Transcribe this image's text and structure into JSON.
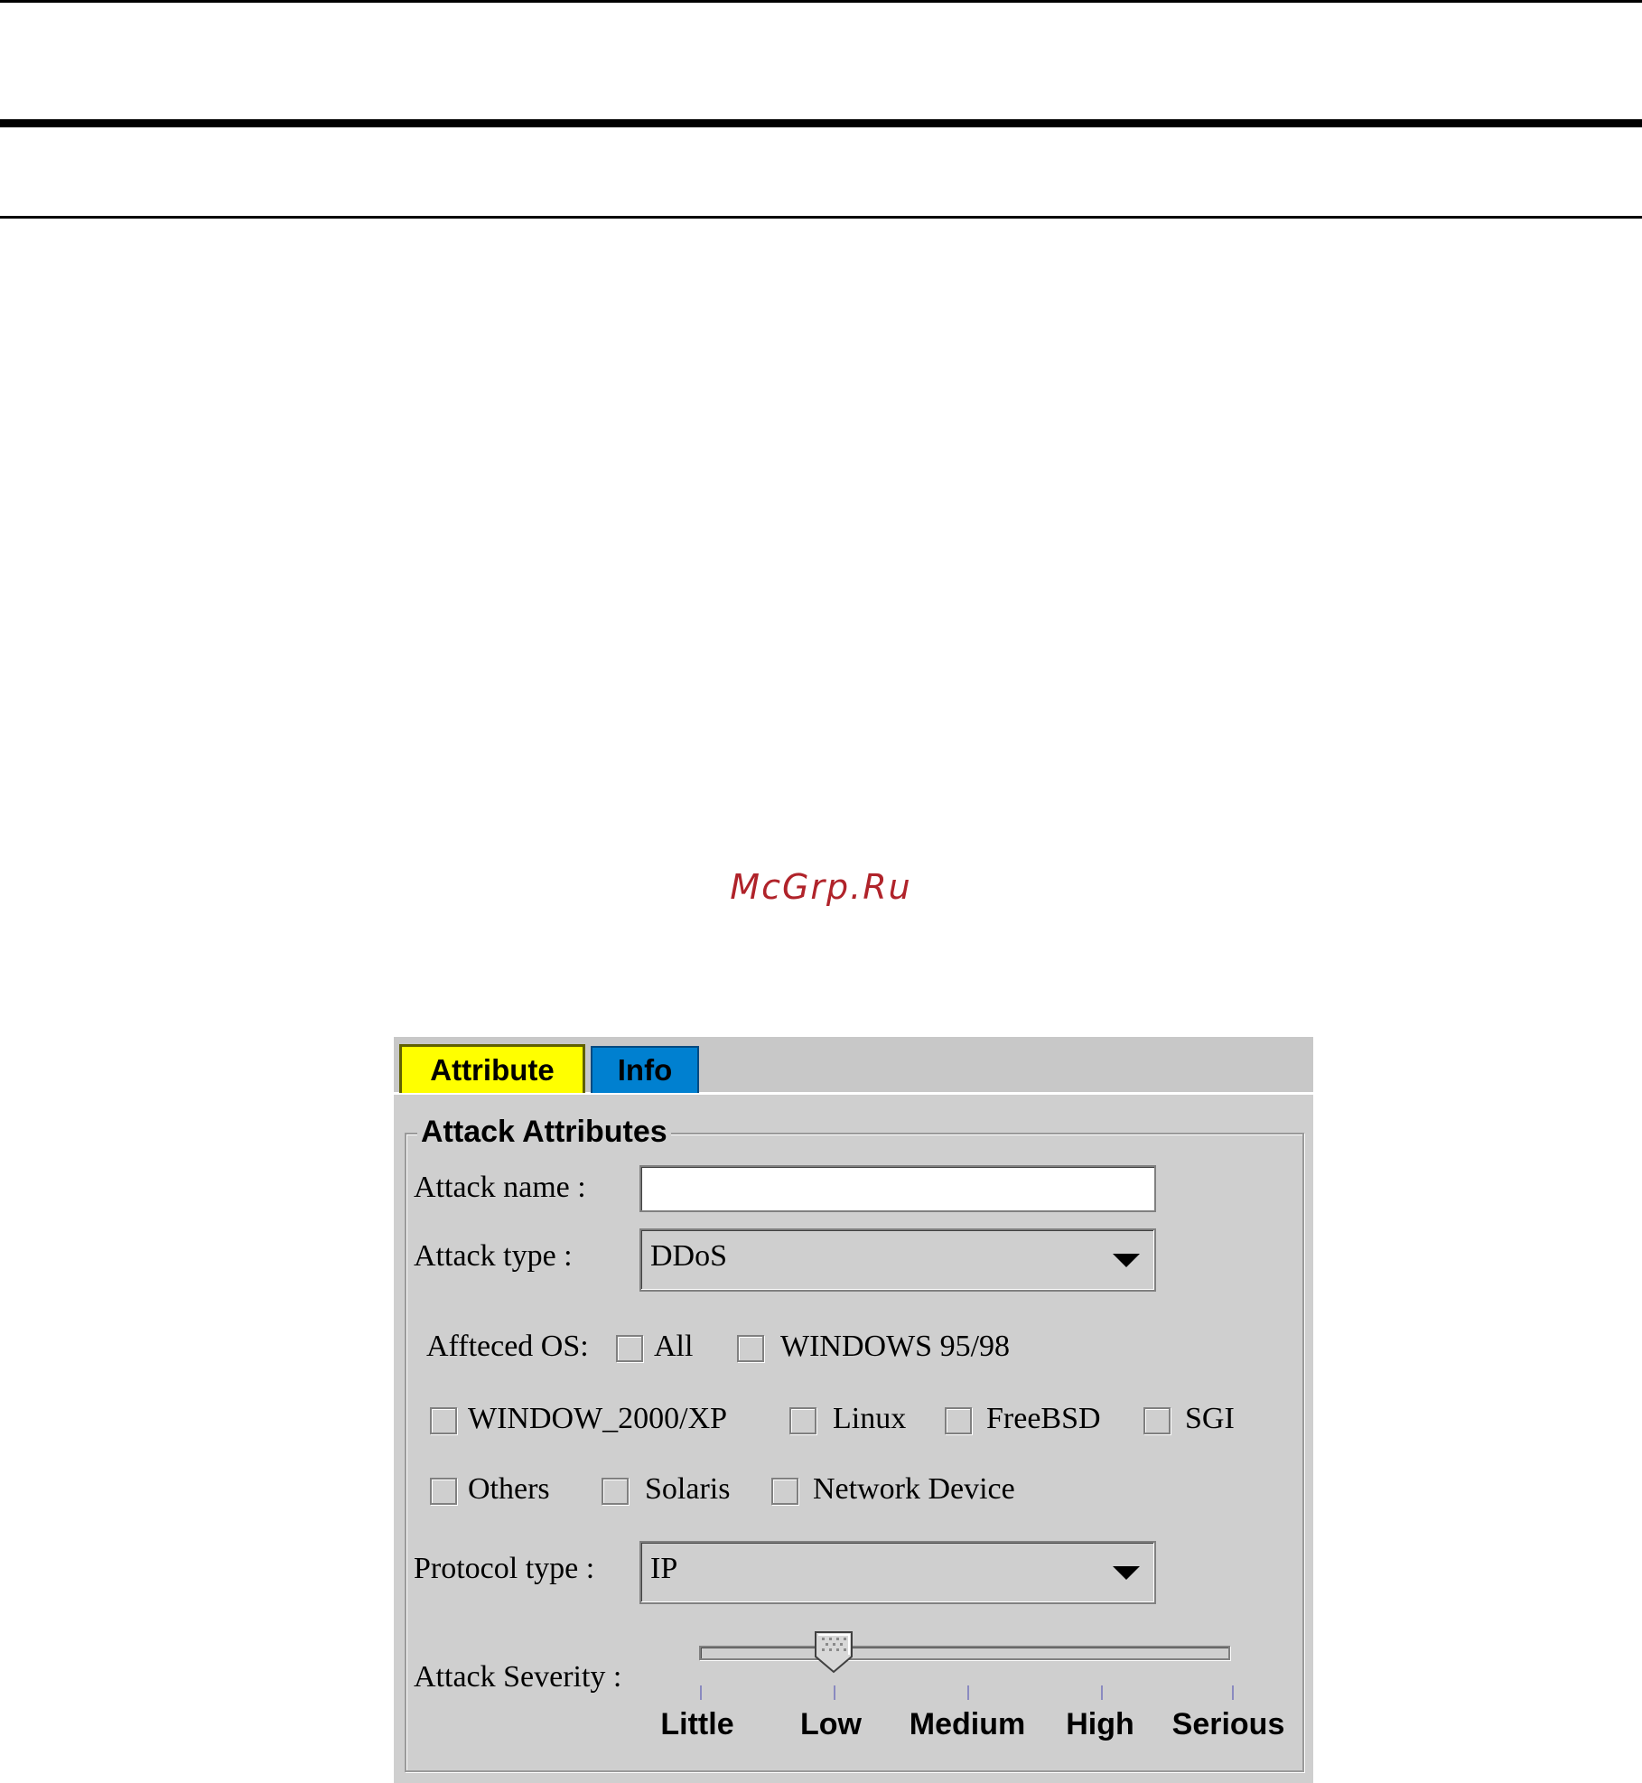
{
  "watermark": "McGrp.Ru",
  "tabs": {
    "attribute": "Attribute",
    "info": "Info"
  },
  "group_title": "Attack Attributes",
  "attack_name": {
    "label": "Attack name :",
    "value": ""
  },
  "attack_type": {
    "label": "Attack type :",
    "value": "DDoS"
  },
  "affected_os": {
    "label": "Affteced OS:",
    "options": {
      "all": "All",
      "win9598": "WINDOWS 95/98",
      "win2000xp": "WINDOW_2000/XP",
      "linux": "Linux",
      "freebsd": "FreeBSD",
      "sgi": "SGI",
      "others": "Others",
      "solaris": "Solaris",
      "network": "Network Device"
    }
  },
  "protocol_type": {
    "label": "Protocol type :",
    "value": "IP"
  },
  "severity": {
    "label": "Attack Severity :",
    "levels": {
      "little": "Little",
      "low": "Low",
      "medium": "Medium",
      "high": "High",
      "serious": "Serious"
    },
    "selected": "Low"
  },
  "colors": {
    "tab_active": "#ffff00",
    "tab_inactive": "#0080d0",
    "panel": "#cfcfcf",
    "watermark": "#b0232a"
  }
}
